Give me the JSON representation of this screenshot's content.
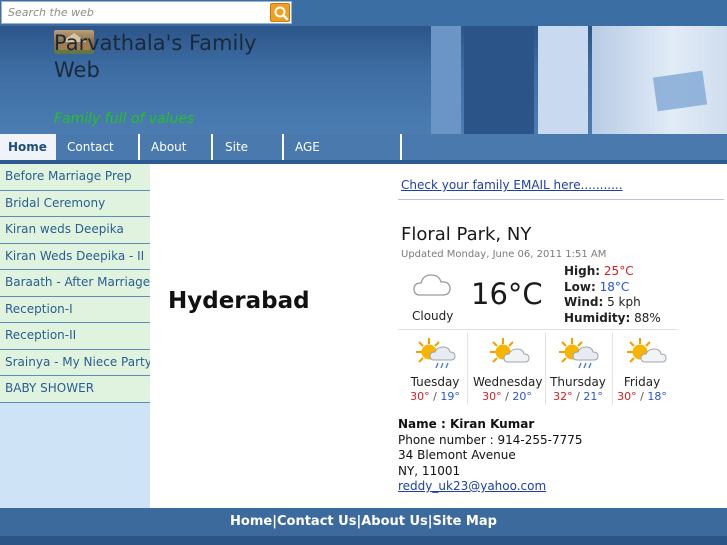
{
  "search": {
    "placeholder": "Search the web"
  },
  "header": {
    "title": "Parvathala's Family Web",
    "tagline": "Family full of values"
  },
  "nav": [
    "Home",
    "Contact Us",
    "About Us",
    "Site Map",
    "AGE CALCULATOR"
  ],
  "sidebar": {
    "items": [
      "Before Marriage Prep",
      "Bridal Ceremony",
      "Kiran weds Deepika",
      "Kiran Weds Deepika - II",
      "Baraath - After Marriage",
      "Reception-I",
      "Reception-II",
      "Srainya - My Niece Party",
      "BABY SHOWER"
    ]
  },
  "main": {
    "city_heading": "Hyderabad",
    "email_link": "Check your family EMAIL here..........."
  },
  "weather": {
    "location": "Floral Park, NY",
    "updated": "Updated Monday, June 06, 2011 1:51 AM",
    "condition": "Cloudy",
    "condition_icon": "cloud-icon",
    "temp": "16°C",
    "high_label": "High:",
    "high": "25°C",
    "low_label": "Low:",
    "low": "18°C",
    "wind_label": "Wind:",
    "wind": "5 kph",
    "humidity_label": "Humidity:",
    "humidity": "88%",
    "forecast": [
      {
        "day": "Tuesday",
        "hi": "30°",
        "lo": "19°",
        "icon": "sun-cloud-rain-icon"
      },
      {
        "day": "Wednesday",
        "hi": "30°",
        "lo": "20°",
        "icon": "sun-cloud-icon"
      },
      {
        "day": "Thursday",
        "hi": "32°",
        "lo": "21°",
        "icon": "sun-cloud-rain-icon"
      },
      {
        "day": "Friday",
        "hi": "30°",
        "lo": "18°",
        "icon": "sun-cloud-icon"
      }
    ],
    "separator": "/",
    "colors": {
      "high": "#d42020",
      "low": "#2454d6"
    }
  },
  "contact": {
    "name": "Name : Kiran Kumar",
    "phone": "Phone number : 914-255-7775",
    "address1": "34 Blemont Avenue",
    "address2": "NY, 11001",
    "email": "reddy_uk23@yahoo.com"
  },
  "footer": {
    "links": [
      "Home",
      "Contact Us",
      "About Us",
      "Site Map"
    ],
    "separator": "|"
  },
  "colors": {
    "nav_bg": "#4a79ad",
    "sidebar_item_bg": "#dff3df",
    "footer_bg": "#3d6a9d",
    "tagline": "#22c322"
  }
}
